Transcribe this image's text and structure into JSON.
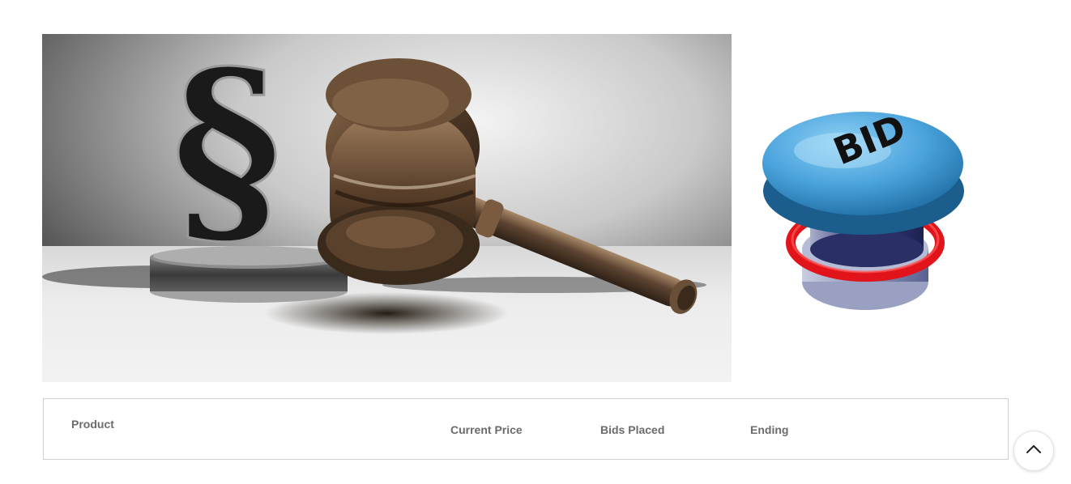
{
  "hero": {
    "alt_label": "gavel-and-paragraph-image"
  },
  "bid_button_image": {
    "text": "BID"
  },
  "table": {
    "headers": {
      "product": "Product",
      "current_price": "Current Price",
      "bids_placed": "Bids Placed",
      "ending": "Ending"
    }
  },
  "icons": {
    "scroll_top": "chevron-up-icon"
  },
  "colors": {
    "border": "#cfcfcf",
    "header_text": "#6b6b6b",
    "bid_blue": "#4aa3dc",
    "bid_red": "#e0141a"
  }
}
